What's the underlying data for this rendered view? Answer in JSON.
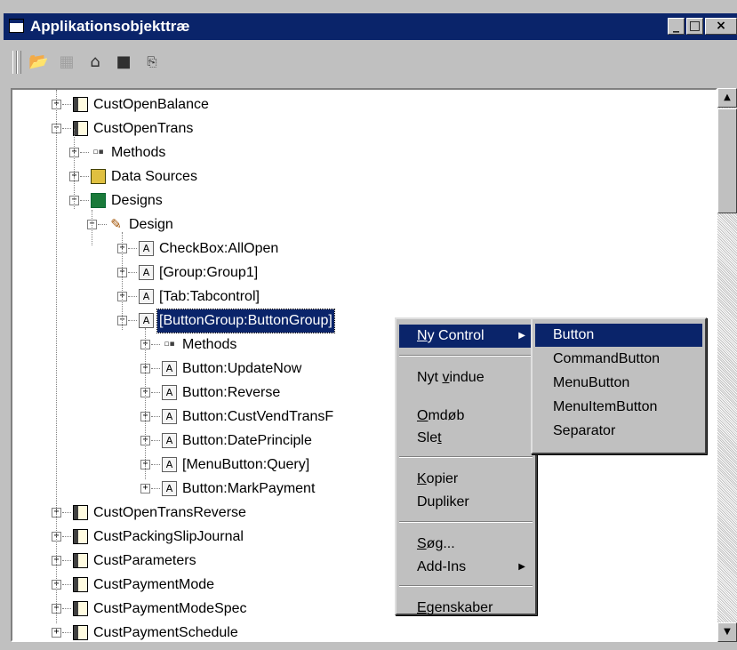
{
  "window": {
    "title": "Applikationsobjekttræ",
    "controls": [
      "_",
      "□",
      "×"
    ]
  },
  "toolbar": {
    "icons": [
      "open-icon",
      "save-icon",
      "properties-icon",
      "compile-icon",
      "find-icon"
    ]
  },
  "tree": {
    "items": [
      {
        "label": "CustOpenBalance",
        "expander": "+",
        "icon": "form-icon"
      },
      {
        "label": "CustOpenTrans",
        "expander": "−",
        "icon": "form-icon"
      },
      {
        "label": "Methods",
        "expander": "+",
        "icon": "methods-icon"
      },
      {
        "label": "Data Sources",
        "expander": "+",
        "icon": "datasource-icon"
      },
      {
        "label": "Designs",
        "expander": "−",
        "icon": "designs-icon"
      },
      {
        "label": "Design",
        "expander": "−",
        "icon": "design-icon"
      },
      {
        "label": "CheckBox:AllOpen",
        "expander": "+",
        "icon": "control-icon",
        "icon_glyph": "A"
      },
      {
        "label": "[Group:Group1]",
        "expander": "+",
        "icon": "control-icon",
        "icon_glyph": "A"
      },
      {
        "label": "[Tab:Tabcontrol]",
        "expander": "+",
        "icon": "control-icon",
        "icon_glyph": "A"
      },
      {
        "label": "[ButtonGroup:ButtonGroup]",
        "expander": "−",
        "icon": "control-icon",
        "icon_glyph": "A",
        "selected": true
      },
      {
        "label": "Methods",
        "expander": "+",
        "icon": "methods-icon"
      },
      {
        "label": "Button:UpdateNow",
        "expander": "+",
        "icon": "control-icon",
        "icon_glyph": "A"
      },
      {
        "label": "Button:Reverse",
        "expander": "+",
        "icon": "control-icon",
        "icon_glyph": "A"
      },
      {
        "label": "Button:CustVendTransF",
        "expander": "+",
        "icon": "control-icon",
        "icon_glyph": "A"
      },
      {
        "label": "Button:DatePrinciple",
        "expander": "+",
        "icon": "control-icon",
        "icon_glyph": "A"
      },
      {
        "label": "[MenuButton:Query]",
        "expander": "+",
        "icon": "control-icon",
        "icon_glyph": "A"
      },
      {
        "label": "Button:MarkPayment",
        "expander": "+",
        "icon": "control-icon",
        "icon_glyph": "A"
      },
      {
        "label": "CustOpenTransReverse",
        "expander": "+",
        "icon": "form-icon"
      },
      {
        "label": "CustPackingSlipJournal",
        "expander": "+",
        "icon": "form-icon"
      },
      {
        "label": "CustParameters",
        "expander": "+",
        "icon": "form-icon"
      },
      {
        "label": "CustPaymentMode",
        "expander": "+",
        "icon": "form-icon"
      },
      {
        "label": "CustPaymentModeSpec",
        "expander": "+",
        "icon": "form-icon"
      },
      {
        "label": "CustPaymentSchedule",
        "expander": "+",
        "icon": "form-icon"
      }
    ]
  },
  "scrollbar": {
    "up": "▲",
    "down": "▼"
  },
  "context_menu": {
    "items": [
      {
        "label": "Ny Control",
        "accel": "N",
        "submenu": "▶",
        "highlighted": true
      },
      {
        "label": "Nyt vindue",
        "accel": "v"
      },
      {
        "label": "Omdøb",
        "accel": "O"
      },
      {
        "label": "Slet",
        "accel": "t"
      },
      {
        "label": "Kopier",
        "accel": "K"
      },
      {
        "label": "Dupliker"
      },
      {
        "label": "Søg...",
        "accel": "S"
      },
      {
        "label": "Add-Ins",
        "submenu": "▶"
      },
      {
        "label": "Egenskaber",
        "accel": "E"
      }
    ]
  },
  "submenu": {
    "items": [
      {
        "label": "Button",
        "highlighted": true
      },
      {
        "label": "CommandButton"
      },
      {
        "label": "MenuButton"
      },
      {
        "label": "MenuItemButton"
      },
      {
        "label": "Separator"
      }
    ]
  }
}
